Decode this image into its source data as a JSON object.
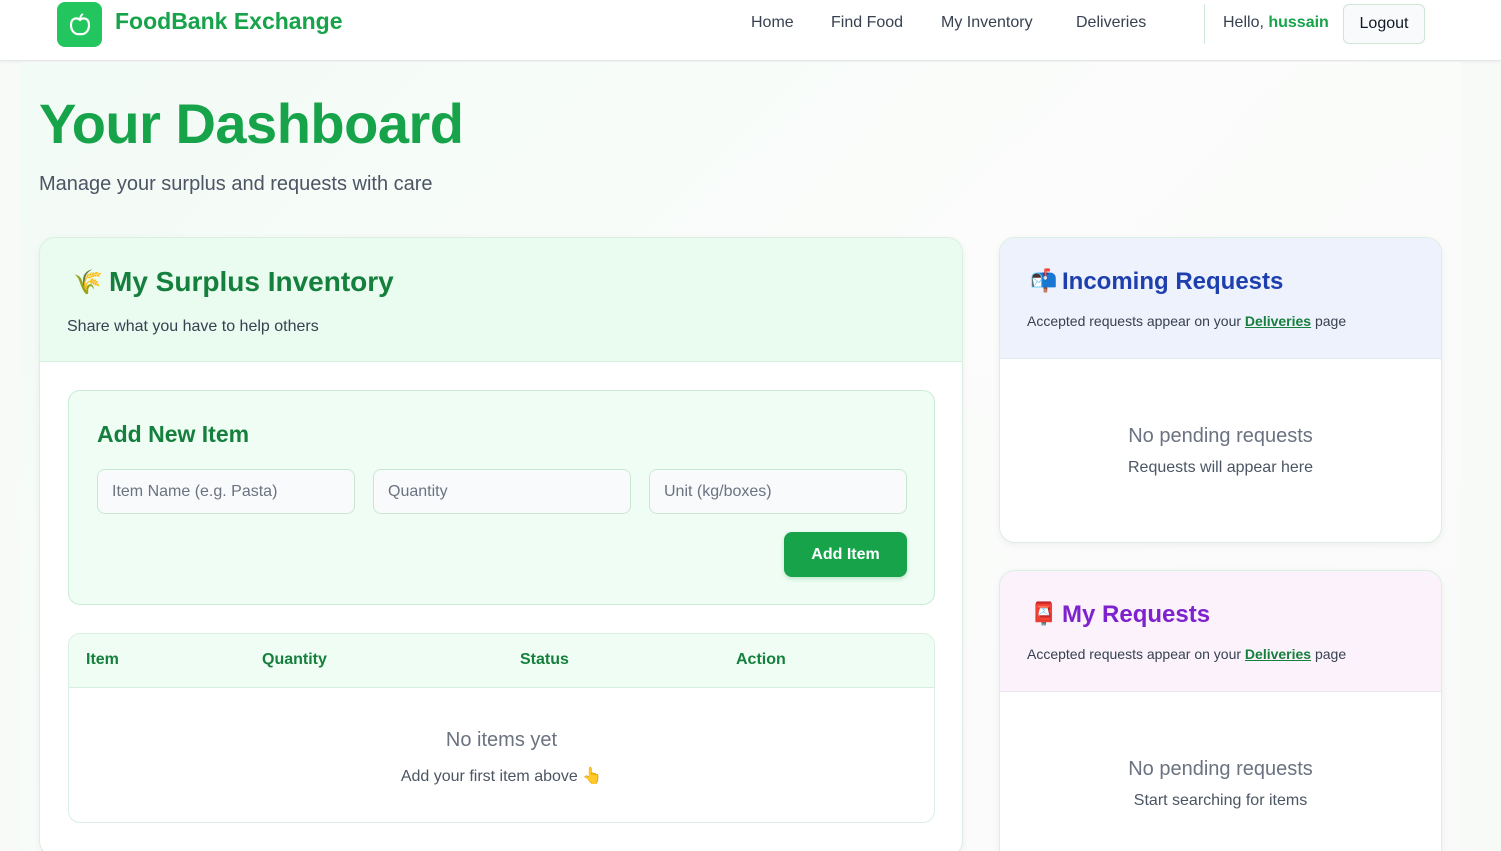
{
  "nav": {
    "brand": "FoodBank Exchange",
    "links": [
      "Home",
      "Find Food",
      "My Inventory",
      "Deliveries"
    ],
    "greeting": "Hello,",
    "username": "hussain",
    "logout": "Logout"
  },
  "page": {
    "title": "Your Dashboard",
    "subtitle": "Manage your surplus and requests with care"
  },
  "inventory": {
    "icon": "🌾",
    "title": "My Surplus Inventory",
    "subtitle": "Share what you have to help others",
    "form": {
      "title": "Add New Item",
      "item_placeholder": "Item Name (e.g. Pasta)",
      "quantity_placeholder": "Quantity",
      "unit_placeholder": "Unit (kg/boxes)",
      "submit": "Add Item"
    },
    "table": {
      "columns": [
        "Item",
        "Quantity",
        "Status",
        "Action"
      ],
      "empty_title": "No items yet",
      "empty_sub": "Add your first item above 👆"
    }
  },
  "incoming": {
    "icon": "📬",
    "title": "Incoming Requests",
    "note_prefix": "Accepted requests appear on your",
    "note_link": "Deliveries",
    "note_suffix": "page",
    "empty_title": "No pending requests",
    "empty_sub": "Requests will appear here"
  },
  "my_requests": {
    "icon": "📮",
    "title": "My Requests",
    "note_prefix": "Accepted requests appear on your",
    "note_link": "Deliveries",
    "note_suffix": "page",
    "empty_title": "No pending requests",
    "empty_sub": "Start searching for items"
  },
  "colors": {
    "brand_green": "#16a34a",
    "incoming_blue": "#1e40af",
    "requests_purple": "#7e22ce"
  }
}
